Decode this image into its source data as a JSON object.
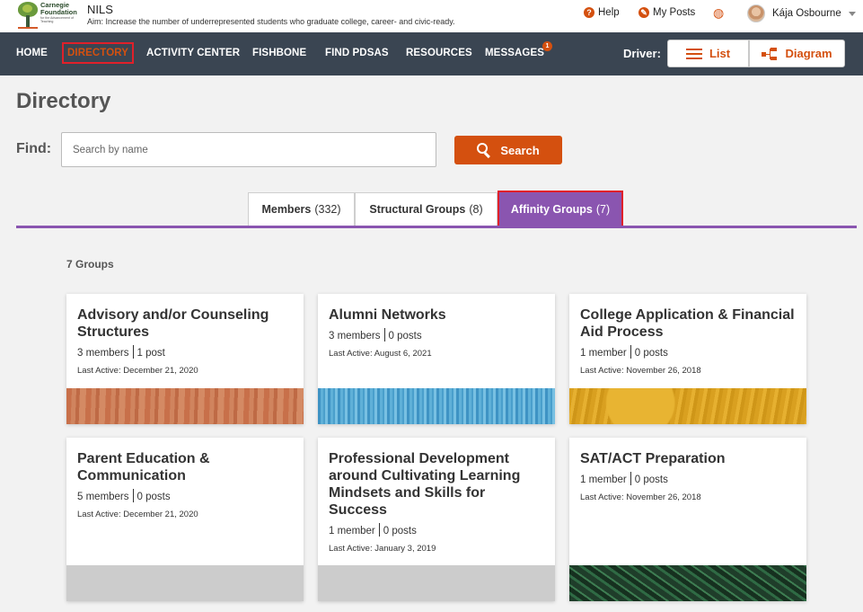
{
  "header": {
    "logo": {
      "name": "Carnegie Foundation",
      "tagline": "for the Advancement of Teaching"
    },
    "app_title": "NILS",
    "aim": "Aim:  Increase the number of underrepresented students who graduate college, career- and civic-ready.",
    "help_label": "Help",
    "my_posts_label": "My Posts",
    "user_name": "Kája Osbourne"
  },
  "nav": {
    "items": [
      {
        "label": "HOME"
      },
      {
        "label": "DIRECTORY"
      },
      {
        "label": "ACTIVITY CENTER"
      },
      {
        "label": "FISHBONE"
      },
      {
        "label": "FIND PDSAS"
      },
      {
        "label": "RESOURCES"
      },
      {
        "label": "MESSAGES"
      }
    ],
    "messages_badge": "1",
    "driver_label": "Driver:",
    "list_button": "List",
    "diagram_button": "Diagram"
  },
  "page": {
    "title": "Directory",
    "find_label": "Find:",
    "search_placeholder": "Search by name",
    "search_value": "",
    "search_button": "Search"
  },
  "tabs": [
    {
      "label": "Members",
      "count": "(332)"
    },
    {
      "label": "Structural Groups",
      "count": "(8)"
    },
    {
      "label": "Affinity Groups",
      "count": "(7)"
    }
  ],
  "groups_count": "7 Groups",
  "groups": [
    {
      "title": "Advisory and/or Counseling Structures",
      "members": "3 members",
      "posts": "1 post",
      "last_active": "Last Active: December 21, 2020"
    },
    {
      "title": "Alumni Networks",
      "members": "3 members",
      "posts": "0 posts",
      "last_active": "Last Active: August 6, 2021"
    },
    {
      "title": "College Application & Financial Aid Process",
      "members": "1 member",
      "posts": "0 posts",
      "last_active": "Last Active: November 26, 2018"
    },
    {
      "title": "Parent Education & Communication",
      "members": "5 members",
      "posts": "0 posts",
      "last_active": "Last Active: December 21, 2020"
    },
    {
      "title": "Professional Development around Cultivating Learning Mindsets and Skills for Success",
      "members": "1 member",
      "posts": "0 posts",
      "last_active": "Last Active: January 3, 2019"
    },
    {
      "title": "SAT/ACT Preparation",
      "members": "1 member",
      "posts": "0 posts",
      "last_active": "Last Active: November 26, 2018"
    }
  ]
}
